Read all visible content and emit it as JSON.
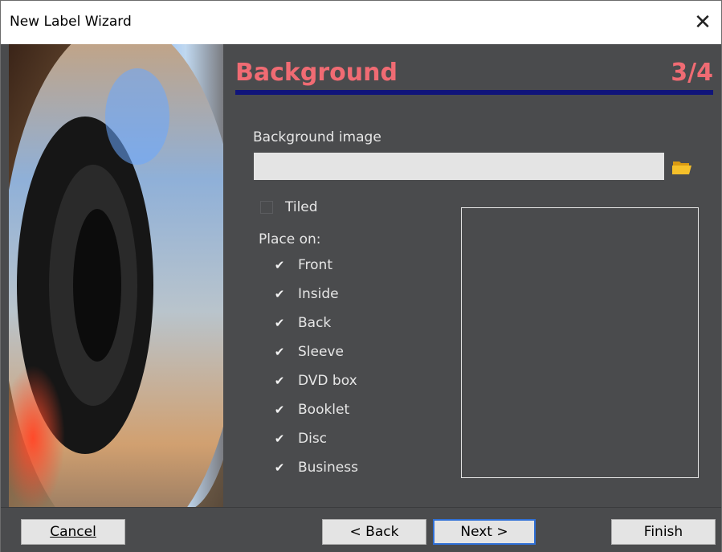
{
  "window": {
    "title": "New Label Wizard",
    "close_glyph": "✕"
  },
  "header": {
    "title": "Background",
    "step": "3/4"
  },
  "background_image": {
    "label": "Background image",
    "value": "",
    "placeholder": ""
  },
  "tiled": {
    "label": "Tiled",
    "checked": false
  },
  "place_on": {
    "label": "Place on:",
    "items": [
      {
        "label": "Front",
        "checked": true
      },
      {
        "label": "Inside",
        "checked": true
      },
      {
        "label": "Back",
        "checked": true
      },
      {
        "label": "Sleeve",
        "checked": true
      },
      {
        "label": "DVD box",
        "checked": true
      },
      {
        "label": "Booklet",
        "checked": true
      },
      {
        "label": "Disc",
        "checked": true
      },
      {
        "label": "Business",
        "checked": true
      }
    ]
  },
  "buttons": {
    "cancel": {
      "label": "Cancel",
      "mnemonic": "C"
    },
    "back": {
      "label": "< Back",
      "mnemonic": "B"
    },
    "next": {
      "label": "Next >",
      "mnemonic": "N"
    },
    "finish": {
      "label": "Finish",
      "mnemonic": "F"
    }
  },
  "check_glyph": "✔",
  "colors": {
    "accent": "#f06b73",
    "rule": "#10147a",
    "panel": "#4a4b4d",
    "default_button_border": "#2f6fd6"
  },
  "icons": {
    "browse": "folder-open-icon",
    "close": "close-icon",
    "check": "checkmark-icon"
  }
}
